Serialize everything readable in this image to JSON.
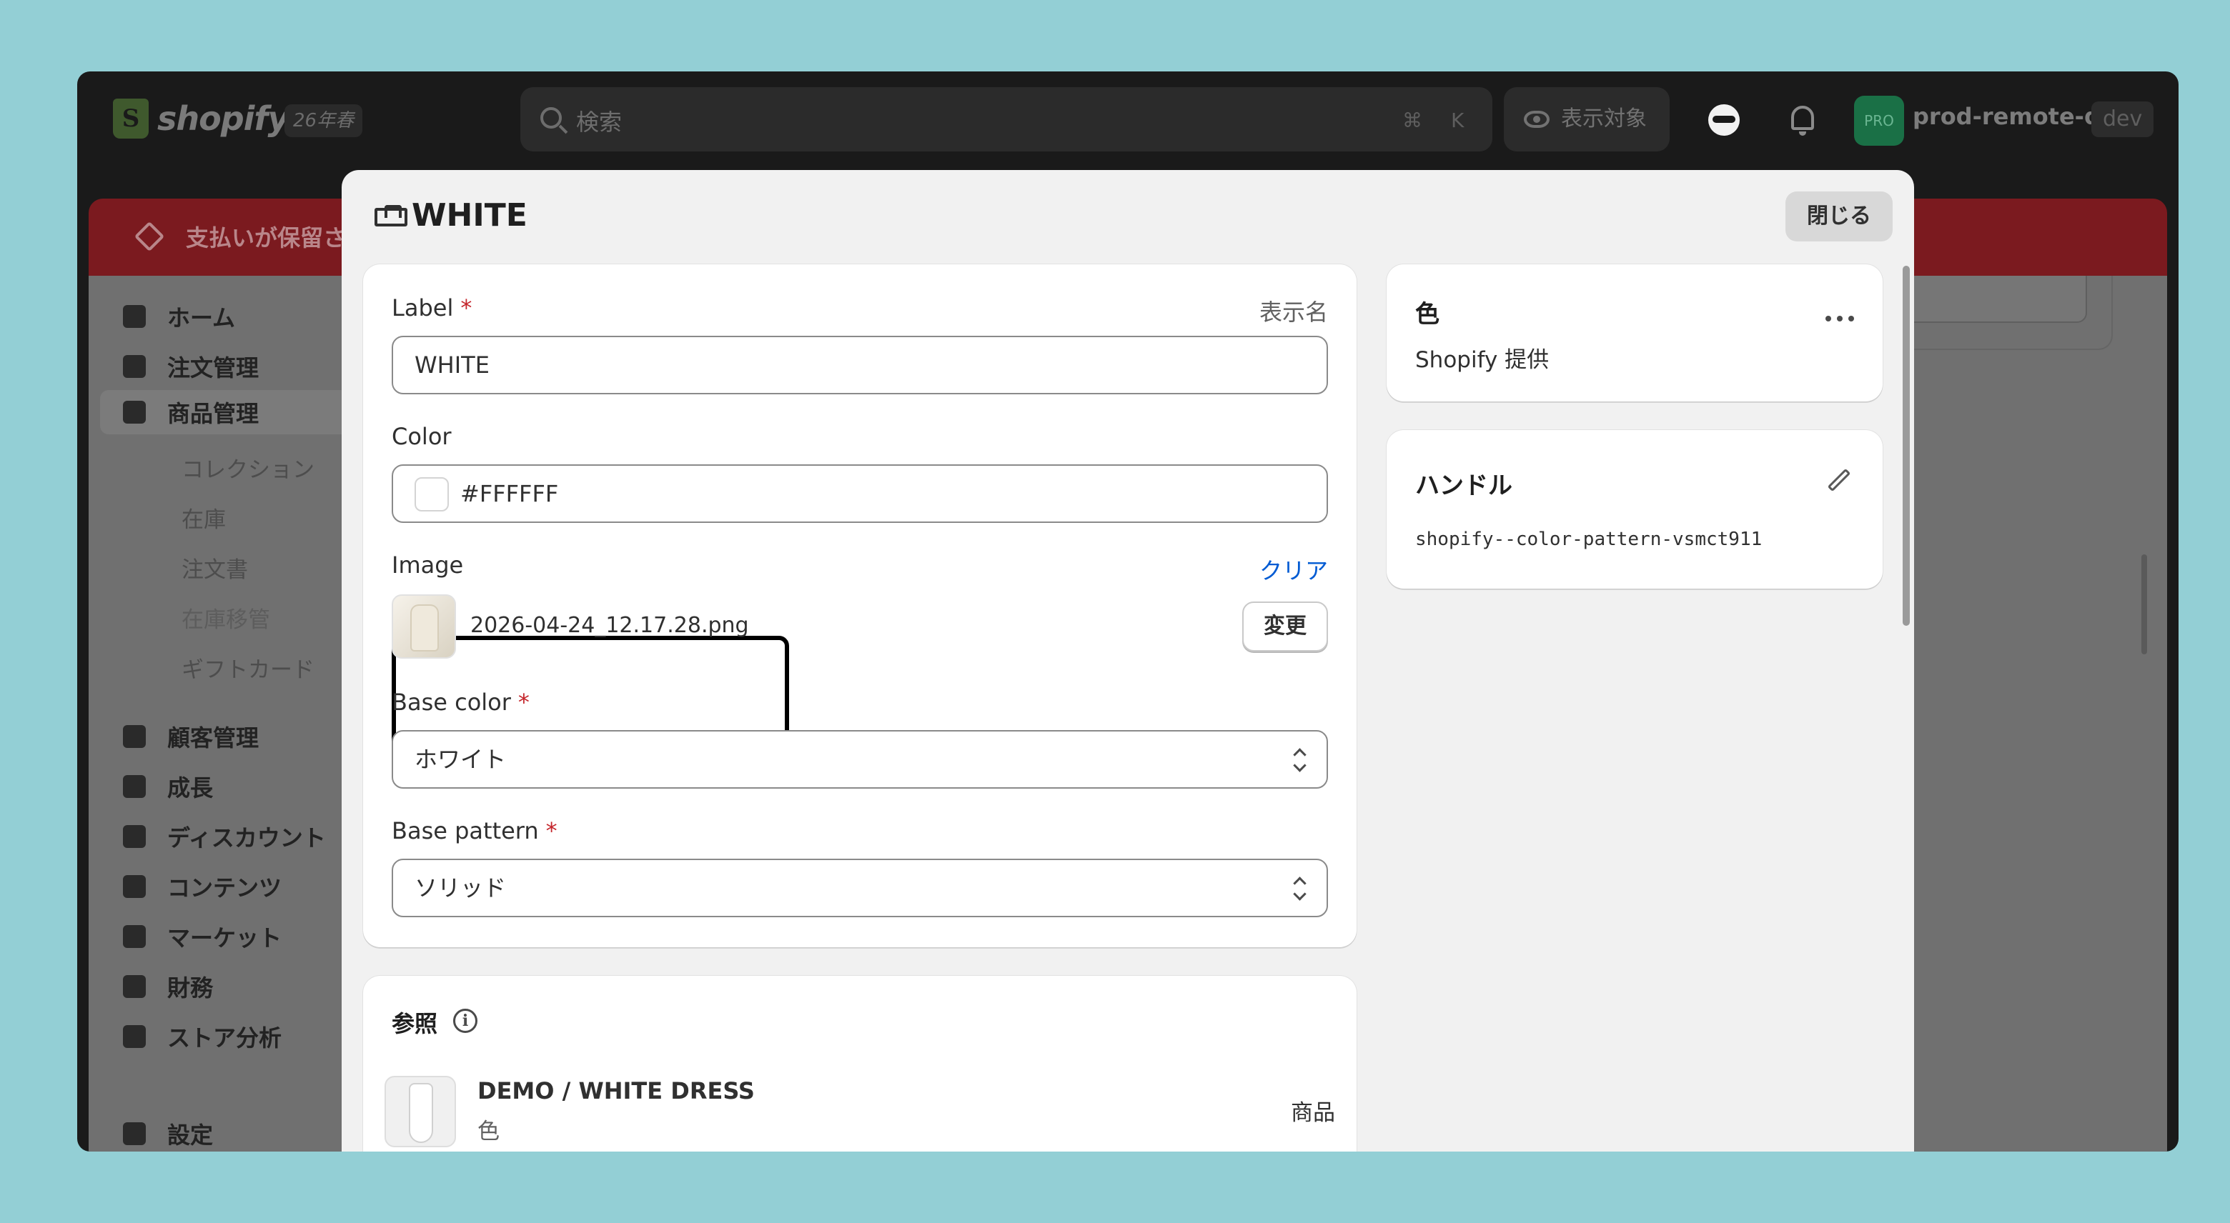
{
  "topbar": {
    "logo_text": "shopify",
    "season_badge": "26年春",
    "search_placeholder": "検索",
    "shortcut_cmd": "⌘",
    "shortcut_key": "K",
    "view_label": "表示対象",
    "avatar_initials": "PRO",
    "store_name": "prod-remote-qa",
    "env_tag": "dev"
  },
  "banner": {
    "text": "支払いが保留さ"
  },
  "sidebar": {
    "items": [
      {
        "label": "ホーム",
        "icon": "home-icon"
      },
      {
        "label": "注文管理",
        "icon": "inbox-icon"
      },
      {
        "label": "商品管理",
        "icon": "tag-icon",
        "active": true
      },
      {
        "label": "顧客管理",
        "icon": "person-icon"
      },
      {
        "label": "成長",
        "icon": "gauge-icon"
      },
      {
        "label": "ディスカウント",
        "icon": "discount-icon"
      },
      {
        "label": "コンテンツ",
        "icon": "content-icon"
      },
      {
        "label": "マーケット",
        "icon": "globe-icon"
      },
      {
        "label": "財務",
        "icon": "bank-icon"
      },
      {
        "label": "ストア分析",
        "icon": "bar-chart-icon"
      }
    ],
    "sub_items": [
      "コレクション",
      "在庫",
      "注文書",
      "在庫移管",
      "ギフトカード"
    ],
    "settings_label": "設定"
  },
  "modal": {
    "title": "WHITE",
    "close_label": "閉じる",
    "label_field": {
      "label": "Label",
      "required": "*",
      "hint": "表示名",
      "value": "WHITE"
    },
    "color_field": {
      "label": "Color",
      "value": "#FFFFFF"
    },
    "image_field": {
      "label": "Image",
      "clear_label": "クリア",
      "filename": "2026-04-24_12.17.28.png",
      "change_label": "変更"
    },
    "base_color": {
      "label": "Base color",
      "required": "*",
      "value": "ホワイト"
    },
    "base_pattern": {
      "label": "Base pattern",
      "required": "*",
      "value": "ソリッド"
    },
    "references": {
      "title": "参照",
      "item_title": "DEMO / WHITE DRESS",
      "item_sub": "色",
      "item_type": "商品"
    },
    "side_color": {
      "title": "色",
      "provider": "Shopify 提供"
    },
    "side_handle": {
      "title": "ハンドル",
      "value": "shopify--color-pattern-vsmct911"
    }
  },
  "colors": {
    "accent_link": "#005bd3",
    "required": "#c5272d",
    "banner": "#7b1a1f",
    "swatch": "#FFFFFF"
  }
}
